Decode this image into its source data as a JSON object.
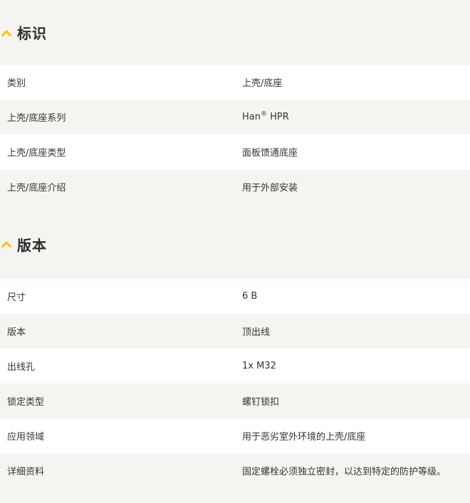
{
  "accent_color": "#f5c400",
  "sections": [
    {
      "title": "标识",
      "icon": "chevron-up-icon",
      "rows": [
        {
          "label": "类别",
          "value": "上壳/底座"
        },
        {
          "label": "上壳/底座系列",
          "value_prefix": "Han",
          "value_sup": "®",
          "value_suffix": " HPR"
        },
        {
          "label": "上壳/底座类型",
          "value": "面板馈通底座"
        },
        {
          "label": "上壳/底座介绍",
          "value": "用于外部安装"
        }
      ]
    },
    {
      "title": "版本",
      "icon": "chevron-up-icon",
      "rows": [
        {
          "label": "尺寸",
          "value": "6 B"
        },
        {
          "label": "版本",
          "value": "顶出线"
        },
        {
          "label": "出线孔",
          "value": "1x M32"
        },
        {
          "label": "锁定类型",
          "value": "螺钉锁扣"
        },
        {
          "label": "应用领域",
          "value": "用于恶劣室外环境的上壳/底座"
        },
        {
          "label": "详细资料",
          "value": "固定螺栓必须独立密封，以达到特定的防护等级。"
        }
      ]
    }
  ]
}
